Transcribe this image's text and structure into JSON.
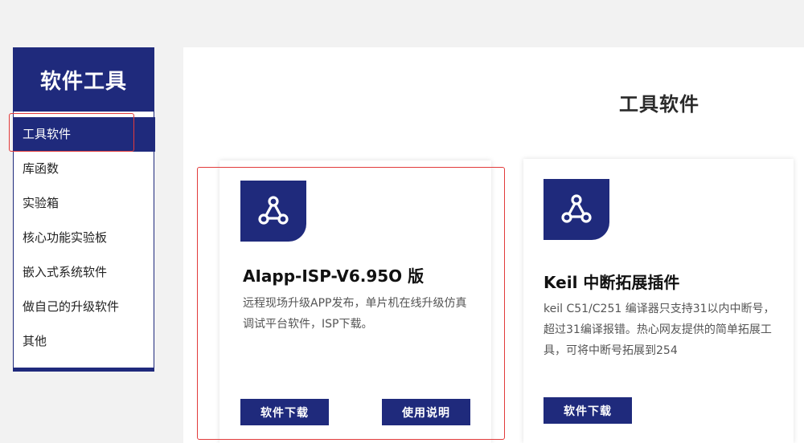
{
  "sidebar": {
    "title": "软件工具",
    "items": [
      {
        "label": "工具软件",
        "active": true
      },
      {
        "label": "库函数"
      },
      {
        "label": "实验箱"
      },
      {
        "label": "核心功能实验板"
      },
      {
        "label": "嵌入式系统软件"
      },
      {
        "label": "做自己的升级软件"
      },
      {
        "label": "其他"
      }
    ]
  },
  "main": {
    "title": "工具软件",
    "cards": [
      {
        "icon": "share-network-icon",
        "title": "AIapp-ISP-V6.95O 版",
        "desc": "远程现场升级APP发布，单片机在线升级仿真调试平台软件，ISP下载。",
        "buttons": [
          "软件下载",
          "使用说明"
        ]
      },
      {
        "icon": "share-network-icon",
        "title": "Keil 中断拓展插件",
        "desc": "keil C51/C251 编译器只支持31以内中断号，超过31编译报错。热心网友提供的简单拓展工具，可将中断号拓展到254",
        "buttons": [
          "软件下载"
        ]
      }
    ]
  },
  "colors": {
    "brand": "#1f2a7c",
    "highlight": "#e23b3b"
  }
}
